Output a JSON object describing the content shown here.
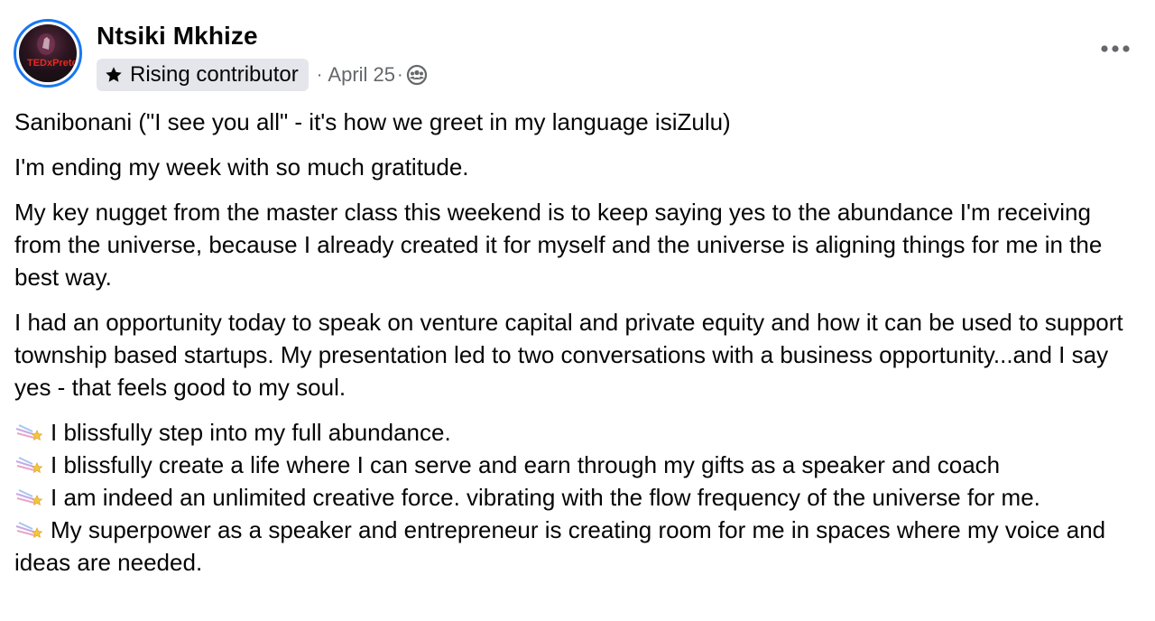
{
  "post": {
    "author": "Ntsiki Mkhize",
    "badge": {
      "label": "Rising contributor",
      "icon": "star-icon"
    },
    "separator": "·",
    "date": "April 25",
    "date_separator": "·",
    "audience_icon": "group-audience-icon",
    "more_icon": "more-options-icon",
    "avatar_text": "TEDxPreto",
    "paragraphs": [
      "Sanibonani (\"I see you all\" - it's how we greet in my language isiZulu)",
      "I'm ending my week with so much gratitude.",
      "My key nugget from the master class this weekend is to keep saying yes to the abundance I'm receiving from the universe, because I already created it for myself and the universe is aligning things for me in the best way.",
      "I had an opportunity today to speak on venture capital and private equity and how it can be used to support township based startups. My presentation led to two conversations with a business opportunity...and I say yes - that feels good to my soul."
    ],
    "affirmations": [
      "I blissfully step into my full abundance.",
      "I blissfully create a life where I can serve and earn through my gifts as a speaker and coach",
      "I am indeed an unlimited creative force. vibrating with the flow frequency of the universe for me.",
      "My superpower as a speaker and entrepreneur is creating room for me in spaces where my voice and ideas are needed."
    ],
    "affirmation_icon": "shooting-star-emoji-icon"
  },
  "colors": {
    "accent": "#1877f2",
    "badge_bg": "#e4e6eb",
    "secondary_text": "#65676b",
    "primary_text": "#050505"
  }
}
